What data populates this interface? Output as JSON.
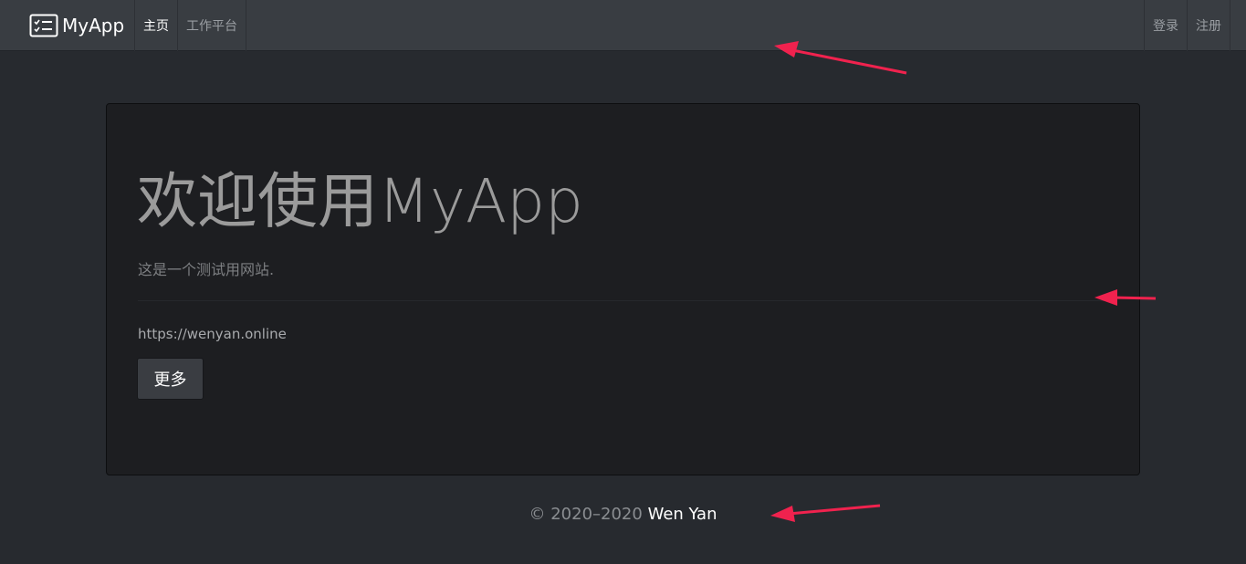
{
  "navbar": {
    "brand": "MyApp",
    "left_items": [
      {
        "label": "主页",
        "active": true
      },
      {
        "label": "工作平台",
        "active": false
      }
    ],
    "right_items": [
      {
        "label": "登录"
      },
      {
        "label": "注册"
      }
    ]
  },
  "jumbotron": {
    "title": "欢迎使用MyApp",
    "lead": "这是一个测试用网站.",
    "url": "https://wenyan.online",
    "more_button": "更多"
  },
  "footer": {
    "copyright": "© 2020–2020",
    "author": "Wen Yan"
  },
  "colors": {
    "page_bg": "#272a2f",
    "navbar_bg": "#393d42",
    "jumbotron_bg": "#1d1e21",
    "annotation_arrow": "#f0224e"
  }
}
